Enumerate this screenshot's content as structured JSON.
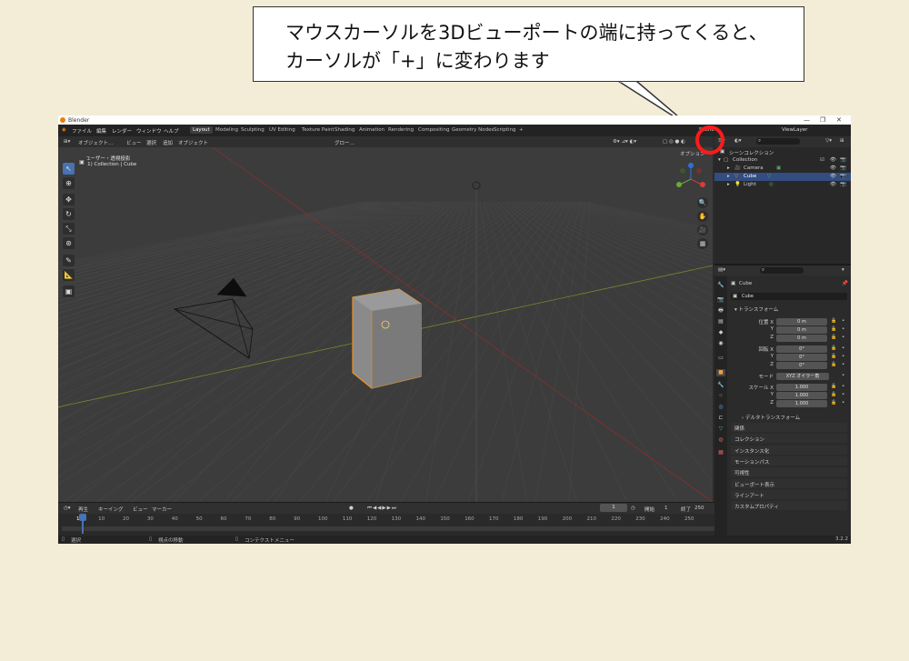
{
  "callout": {
    "line1": "マウスカーソルを3Dビューポートの端に持ってくると、",
    "line2": "カーソルが「+」に変わります"
  },
  "window": {
    "title": "Blender",
    "controls": [
      "—",
      "❐",
      "✕"
    ]
  },
  "menu": [
    "ファイル",
    "編集",
    "レンダー",
    "ウィンドウ",
    "ヘルプ"
  ],
  "workspaces": [
    "Layout",
    "Modeling",
    "Sculpting",
    "UV Editing",
    "Texture Paint",
    "Shading",
    "Animation",
    "Rendering",
    "Compositing",
    "Geometry Nodes",
    "Scripting",
    "+"
  ],
  "scene": "Scene",
  "view_layer": "ViewLayer",
  "viewport_header": {
    "mode": "オブジェクト...",
    "items": [
      "ビュー",
      "選択",
      "追加",
      "オブジェクト"
    ],
    "transform": "グロー...",
    "options": "オプション"
  },
  "viewport_info": {
    "line1": "ユーザー・透視投影",
    "line2": "(1) Collection | Cube"
  },
  "outliner": {
    "root": "シーンコレクション",
    "items": [
      {
        "label": "Collection",
        "selected": false
      },
      {
        "label": "Camera",
        "selected": false
      },
      {
        "label": "Cube",
        "selected": true
      },
      {
        "label": "Light",
        "selected": false
      }
    ]
  },
  "properties": {
    "object_name": "Cube",
    "data_name": "Cube",
    "transform_title": "トランスフォーム",
    "rows": [
      {
        "label": "位置 X",
        "value": "0 m"
      },
      {
        "label": "Y",
        "value": "0 m"
      },
      {
        "label": "Z",
        "value": "0 m"
      },
      {
        "label": "回転 X",
        "value": "0°"
      },
      {
        "label": "Y",
        "value": "0°"
      },
      {
        "label": "Z",
        "value": "0°"
      },
      {
        "label": "モード",
        "value": "XYZ オイラー角"
      },
      {
        "label": "スケール X",
        "value": "1.000"
      },
      {
        "label": "Y",
        "value": "1.000"
      },
      {
        "label": "Z",
        "value": "1.000"
      }
    ],
    "delta": "デルタトランスフォーム",
    "sections": [
      "関係",
      "コレクション",
      "インスタンス化",
      "モーションパス",
      "可視性",
      "ビューポート表示",
      "ラインアート",
      "カスタムプロパティ"
    ]
  },
  "timeline": {
    "items": [
      "再生",
      "キーイング",
      "ビュー",
      "マーカー"
    ],
    "current_frame": "1",
    "start_label": "開始",
    "start": "1",
    "end_label": "終了",
    "end": "250",
    "ticks": [
      "1",
      "10",
      "20",
      "30",
      "40",
      "50",
      "60",
      "70",
      "80",
      "90",
      "100",
      "110",
      "120",
      "130",
      "140",
      "150",
      "160",
      "170",
      "180",
      "190",
      "200",
      "210",
      "220",
      "230",
      "240",
      "250"
    ]
  },
  "status": {
    "select": "選択",
    "pan": "視点の移動",
    "context": "コンテクストメニュー",
    "version": "3.2.2"
  }
}
